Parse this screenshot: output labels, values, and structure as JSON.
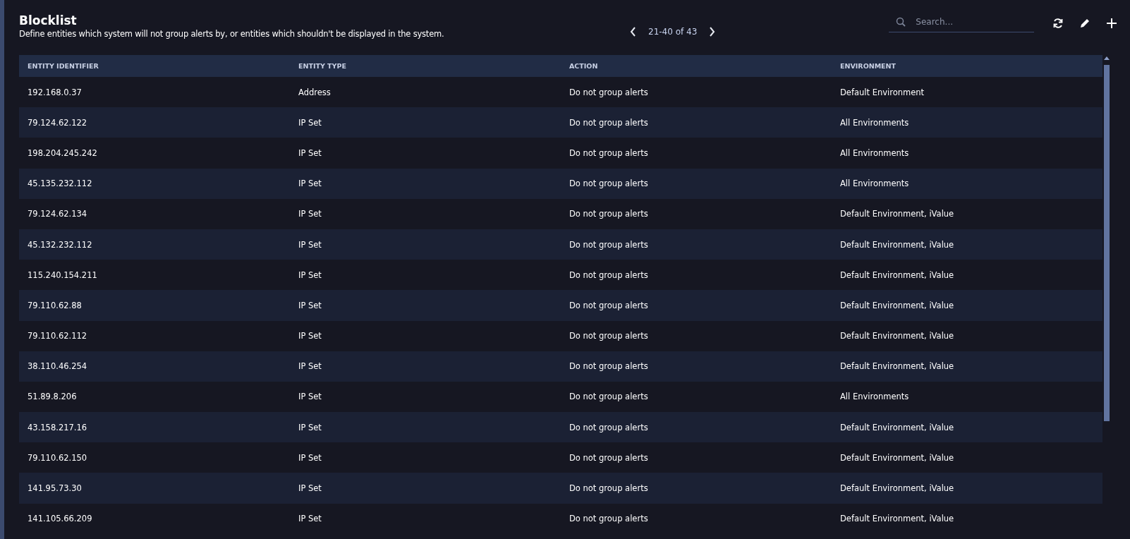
{
  "header": {
    "title": "Blocklist",
    "description": "Define entities which system will not group alerts by, or entities which shouldn't be displayed in the system."
  },
  "pagination": {
    "range": "21-40 of 43"
  },
  "search": {
    "placeholder": "Search..."
  },
  "table": {
    "columns": [
      "ENTITY IDENTIFIER",
      "ENTITY TYPE",
      "ACTION",
      "ENVIRONMENT"
    ],
    "rows": [
      [
        "192.168.0.37",
        "Address",
        "Do not group alerts",
        "Default Environment"
      ],
      [
        "79.124.62.122",
        "IP Set",
        "Do not group alerts",
        "All Environments"
      ],
      [
        "198.204.245.242",
        "IP Set",
        "Do not group alerts",
        "All Environments"
      ],
      [
        "45.135.232.112",
        "IP Set",
        "Do not group alerts",
        "All Environments"
      ],
      [
        "79.124.62.134",
        "IP Set",
        "Do not group alerts",
        "Default Environment, iValue"
      ],
      [
        "45.132.232.112",
        "IP Set",
        "Do not group alerts",
        "Default Environment, iValue"
      ],
      [
        "115.240.154.211",
        "IP Set",
        "Do not group alerts",
        "Default Environment, iValue"
      ],
      [
        "79.110.62.88",
        "IP Set",
        "Do not group alerts",
        "Default Environment, iValue"
      ],
      [
        "79.110.62.112",
        "IP Set",
        "Do not group alerts",
        "Default Environment, iValue"
      ],
      [
        "38.110.46.254",
        "IP Set",
        "Do not group alerts",
        "Default Environment, iValue"
      ],
      [
        "51.89.8.206",
        "IP Set",
        "Do not group alerts",
        "All Environments"
      ],
      [
        "43.158.217.16",
        "IP Set",
        "Do not group alerts",
        "Default Environment, iValue"
      ],
      [
        "79.110.62.150",
        "IP Set",
        "Do not group alerts",
        "Default Environment, iValue"
      ],
      [
        "141.95.73.30",
        "IP Set",
        "Do not group alerts",
        "Default Environment, iValue"
      ],
      [
        "141.105.66.209",
        "IP Set",
        "Do not group alerts",
        "Default Environment, iValue"
      ]
    ]
  }
}
